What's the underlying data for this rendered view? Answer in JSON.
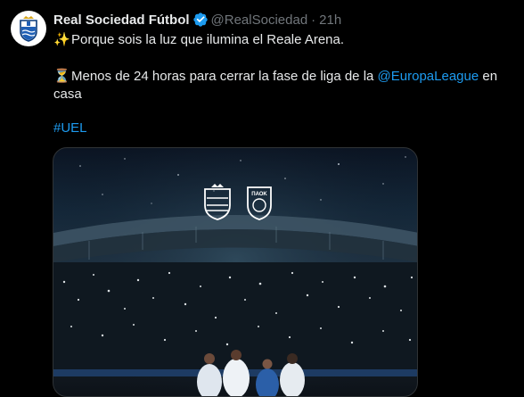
{
  "tweet": {
    "display_name": "Real Sociedad Fútbol",
    "handle": "@RealSociedad",
    "separator": "·",
    "time": "21h",
    "line1_emoji": "✨",
    "line1_text": "Porque sois la luz que ilumina el Reale Arena.",
    "line2_emoji": "⏳",
    "line2_text_before": "Menos de 24 horas para cerrar la fase de liga de la ",
    "line2_mention": "@EuropaLeague",
    "line2_text_after": " en casa",
    "hashtag": "#UEL",
    "media_badge_text": "ΠΑΟΚ",
    "verified_icon": "verified-badge-icon",
    "colors": {
      "link": "#1d9bf0",
      "muted": "#71767b",
      "text": "#e7e9ea",
      "background": "#000000"
    }
  }
}
